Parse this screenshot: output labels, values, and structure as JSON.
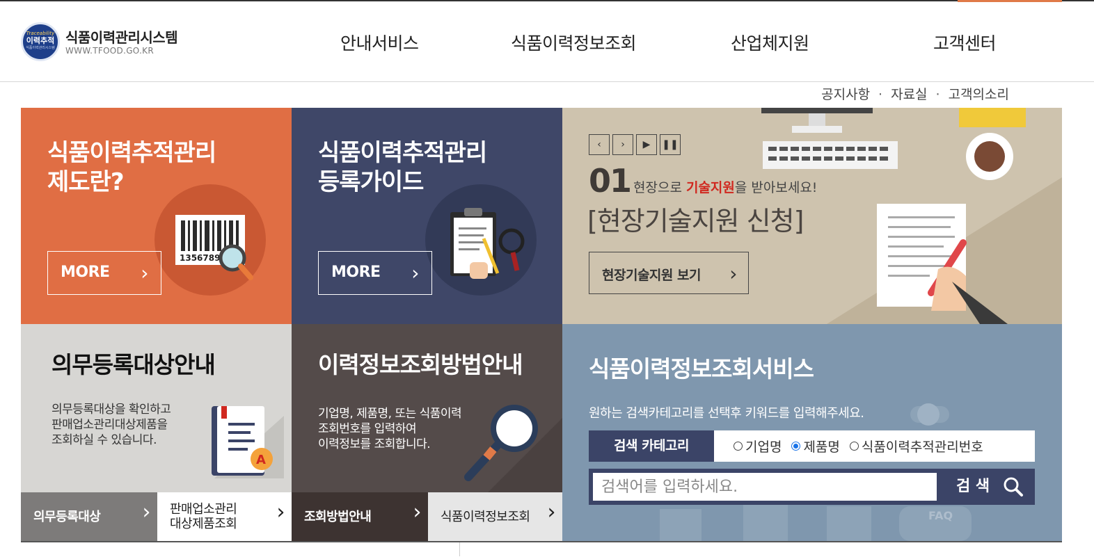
{
  "logo": {
    "emblem_top": "Traceability",
    "emblem_main": "이력추적",
    "emblem_bottom": "식품이력관리시스템",
    "title": "식품이력관리시스템",
    "url": "WWW.TFOOD.GO.KR"
  },
  "nav": [
    "안내서비스",
    "식품이력정보조회",
    "산업체지원",
    "고객센터"
  ],
  "util_links": [
    "공지사항",
    "자료실",
    "고객의소리"
  ],
  "util_separator": "·",
  "panels": {
    "system": {
      "title_line1": "식품이력추적관리",
      "title_line2": "제도란?",
      "more": "MORE",
      "barcode_text": "1356789"
    },
    "guide": {
      "title_line1": "식품이력추적관리",
      "title_line2": "등록가이드",
      "more": "MORE"
    },
    "slider": {
      "number": "01",
      "sub_prefix": "현장으로 ",
      "sub_highlight": "기술지원",
      "sub_suffix": "을 받아보세요!",
      "main": "[현장기술지원 신청]",
      "button": "현장기술지원 보기"
    },
    "mandatory": {
      "title": "의무등록대상안내",
      "desc_line1": "의무등록대상을 확인하고",
      "desc_line2": "판매업소관리대상제품을",
      "desc_line3": "조회하실 수 있습니다."
    },
    "lookup": {
      "title": "이력정보조회방법안내",
      "desc_line1": "기업명, 제품명, 또는 식품이력",
      "desc_line2": "조회번호를 입력하여",
      "desc_line3": "이력정보를 조회합니다."
    },
    "search": {
      "title": "식품이력정보조회서비스",
      "desc": "원하는 검색카테고리를 선택후 키워드를 입력해주세요.",
      "category_label": "검색 카테고리",
      "options": [
        "기업명",
        "제품명",
        "식품이력추적관리번호"
      ],
      "selected": "제품명",
      "placeholder": "검색어를 입력하세요.",
      "value": "",
      "button": "검 색",
      "faq": "FAQ"
    }
  },
  "sub_buttons": {
    "b1": "의무등록대상",
    "b2_line1": "판매업소관리",
    "b2_line2": "대상제품조회",
    "b3": "조회방법안내",
    "b4": "식품이력정보조회"
  },
  "slider_controls": [
    "prev",
    "next",
    "play",
    "pause"
  ],
  "arrow": "›",
  "colors": {
    "orange": "#e06e44",
    "navy": "#3f4768",
    "beige": "#cec3ae",
    "light_gray": "#d7d6d3",
    "brown": "#544b4a",
    "slate_blue": "#7f97ae",
    "highlight_red": "#d0281f"
  }
}
